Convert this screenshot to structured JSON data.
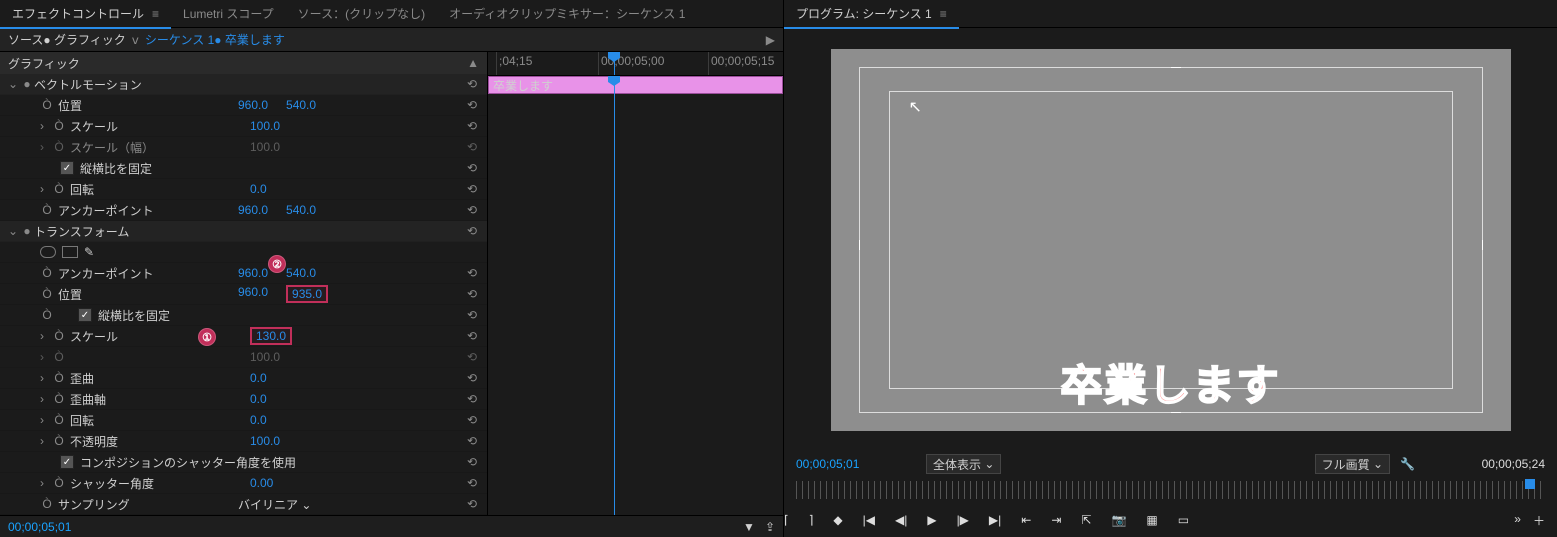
{
  "tabs": {
    "effect_controls": "エフェクトコントロール",
    "lumetri": "Lumetri スコープ",
    "source": "ソース：(クリップなし)",
    "audio_mixer": "オーディオクリップミキサー：シーケンス 1"
  },
  "panel_head": {
    "source": "ソース● グラフィック",
    "chevron": "ⅴ",
    "sequence": "シーケンス 1● 卒業します",
    "play": "▶"
  },
  "section": {
    "label": "グラフィック",
    "triangle": "▲"
  },
  "ruler": {
    "labels": [
      ";04;15",
      "00;00;05;00",
      "00;00;05;15"
    ]
  },
  "clip": {
    "label": "卒業します"
  },
  "groups": {
    "vector_motion": {
      "label": "ベクトルモーション",
      "position": {
        "label": "位置",
        "x": "960.0",
        "y": "540.0"
      },
      "scale": {
        "label": "スケール",
        "v": "100.0"
      },
      "scale_w": {
        "label": "スケール（幅）",
        "v": "100.0"
      },
      "aspect": {
        "label": "縦横比を固定"
      },
      "rotation": {
        "label": "回転",
        "v": "0.0"
      },
      "anchor": {
        "label": "アンカーポイント",
        "x": "960.0",
        "y": "540.0"
      }
    },
    "transform": {
      "label": "トランスフォーム",
      "anchor": {
        "label": "アンカーポイント",
        "x": "960.0",
        "y": "540.0"
      },
      "position": {
        "label": "位置",
        "x": "960.0",
        "y": "935.0"
      },
      "aspect": {
        "label": "縦横比を固定"
      },
      "scale": {
        "label": "スケール",
        "v": "130.0"
      },
      "scale_w": {
        "label": "",
        "v": "100.0"
      },
      "skew": {
        "label": "歪曲",
        "v": "0.0"
      },
      "skew_axis": {
        "label": "歪曲軸",
        "v": "0.0"
      },
      "rotation": {
        "label": "回転",
        "v": "0.0"
      },
      "opacity": {
        "label": "不透明度",
        "v": "100.0"
      },
      "shutter": {
        "label": "コンポジションのシャッター角度を使用"
      },
      "shutter_angle": {
        "label": "シャッター角度",
        "v": "0.00"
      },
      "sampling": {
        "label": "サンプリング",
        "v": "バイリニア"
      }
    }
  },
  "badges": {
    "one": "①",
    "two": "②"
  },
  "icons": {
    "reset": "⟲",
    "tw_open": "⌄",
    "tw_close": "›",
    "dot": "●",
    "stopwatch": "Ò",
    "sq": "□",
    "pick": "✎",
    "filter": "▾",
    "clock": "⏱",
    "share": "⇪"
  },
  "footer": {
    "timecode": "00;00;05;01"
  },
  "program": {
    "title": "プログラム: シーケンス 1",
    "caption": "卒業します",
    "timecode_left": "00;00;05;01",
    "zoom": "全体表示",
    "quality": "フル画質",
    "timecode_right": "00;00;05;24"
  },
  "transport": {
    "mark_in": "⌈",
    "mark_out": "⌉",
    "marker": "◆",
    "goto_in": "|◀",
    "step_back": "◀|",
    "play": "▶",
    "step_fwd": "|▶",
    "goto_out": "▶|",
    "lift": "⇤",
    "extract": "⇥",
    "export": "⇱",
    "snapshot": "📷",
    "safe": "▦",
    "compare": "▭",
    "more": "»",
    "plus": "＋"
  }
}
